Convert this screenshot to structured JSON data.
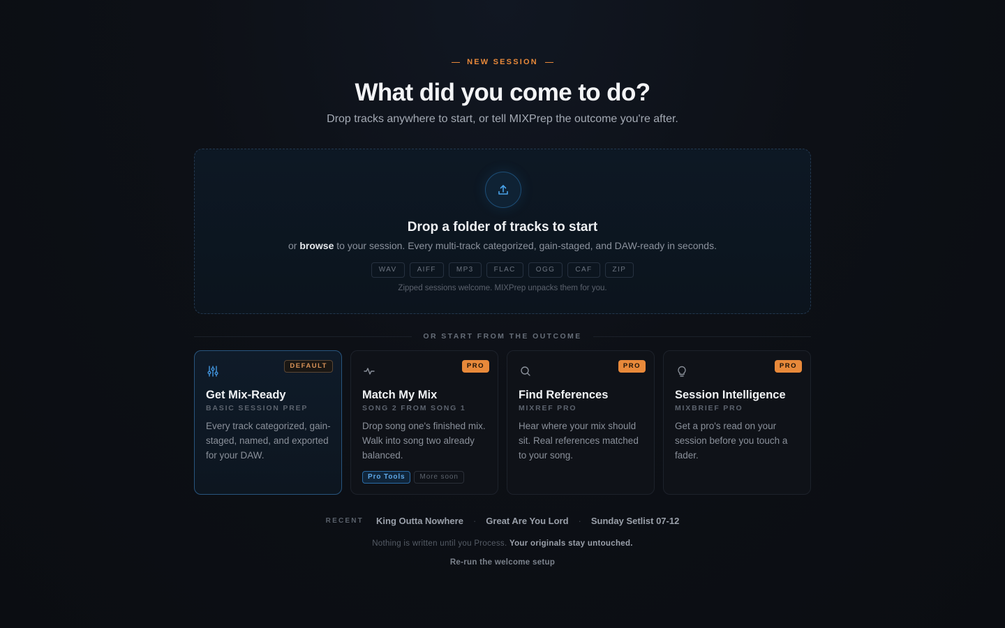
{
  "eyebrow": "NEW SESSION",
  "headline": "What did you come to do?",
  "subhead": "Drop tracks anywhere to start, or tell MIXPrep the outcome you're after.",
  "dropzone": {
    "icon": "upload-icon",
    "title": "Drop a folder of tracks to start",
    "desc_prefix": "or ",
    "browse_label": "browse",
    "desc_suffix": " to your session. Every multi-track categorized, gain-staged, and DAW-ready in seconds.",
    "formats": [
      "WAV",
      "AIFF",
      "MP3",
      "FLAC",
      "OGG",
      "CAF",
      "ZIP"
    ],
    "note": "Zipped sessions welcome. MIXPrep unpacks them for you."
  },
  "divider_label": "OR START FROM THE OUTCOME",
  "cards": [
    {
      "icon": "sliders-icon",
      "badge": "DEFAULT",
      "title": "Get Mix-Ready",
      "subtitle": "BASIC SESSION PREP",
      "desc": "Every track categorized, gain-staged, named, and exported for your DAW."
    },
    {
      "icon": "pulse-icon",
      "badge": "PRO",
      "title": "Match My Mix",
      "subtitle": "SONG 2 FROM SONG 1",
      "desc": "Drop song one's finished mix. Walk into song two already balanced.",
      "chips": [
        "Pro Tools",
        "More soon"
      ]
    },
    {
      "icon": "search-icon",
      "badge": "PRO",
      "title": "Find References",
      "subtitle": "MIXREF PRO",
      "desc": "Hear where your mix should sit. Real references matched to your song."
    },
    {
      "icon": "lightbulb-icon",
      "badge": "PRO",
      "title": "Session Intelligence",
      "subtitle": "MIXBRIEF PRO",
      "desc": "Get a pro's read on your session before you touch a fader."
    }
  ],
  "recent": {
    "label": "RECENT",
    "items": [
      "King Outta Nowhere",
      "Great Are You Lord",
      "Sunday Setlist 07-12"
    ],
    "separator": "·"
  },
  "footnote": {
    "prefix": "Nothing is written until you Process. ",
    "bold": "Your originals stay untouched."
  },
  "rerun_label": "Re-run the welcome setup",
  "colors": {
    "accent": "#e8893a",
    "blue": "#3f8fd6",
    "background": "#0b0d12"
  }
}
